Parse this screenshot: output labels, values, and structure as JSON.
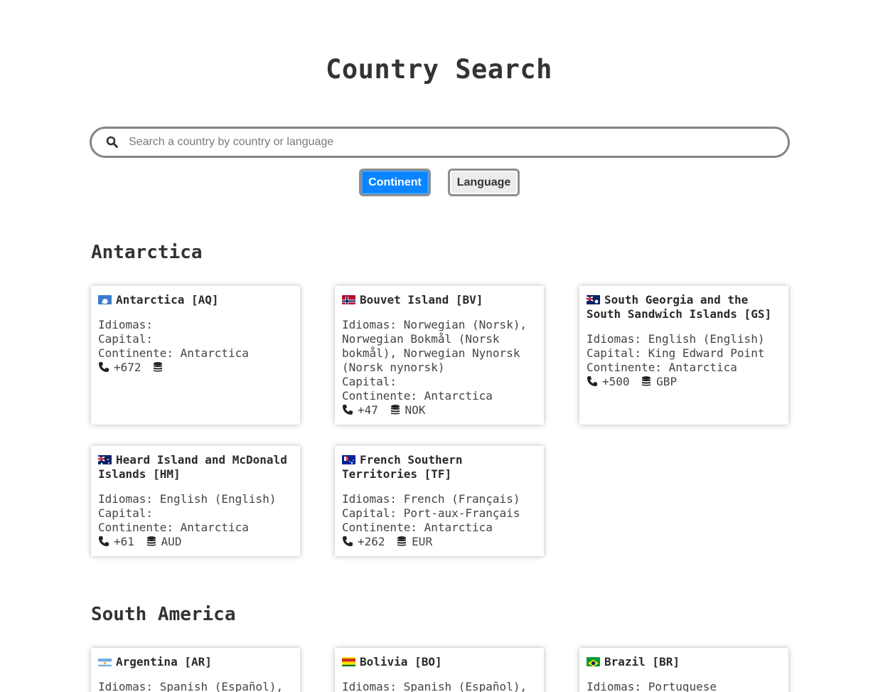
{
  "header": {
    "title": "Country Search"
  },
  "search": {
    "placeholder": "Search a country by country or language",
    "value": ""
  },
  "filters": {
    "continent_label": "Continent",
    "language_label": "Language"
  },
  "sections": [
    {
      "title": "Antarctica",
      "countries": [
        {
          "name": "Antarctica [AQ]",
          "idiomas": "Idiomas:",
          "capital": "Capital:",
          "continente": "Continente: Antarctica",
          "phone": "+672",
          "currency": "",
          "flag": "aq"
        },
        {
          "name": "Bouvet Island [BV]",
          "idiomas": "Idiomas: Norwegian (Norsk), Norwegian Bokmål (Norsk bokmål), Norwegian Nynorsk (Norsk nynorsk)",
          "capital": "Capital:",
          "continente": "Continente: Antarctica",
          "phone": "+47",
          "currency": "NOK",
          "flag": "bv"
        },
        {
          "name": "South Georgia and the South Sandwich Islands [GS]",
          "idiomas": "Idiomas: English (English)",
          "capital": "Capital: King Edward Point",
          "continente": "Continente: Antarctica",
          "phone": "+500",
          "currency": "GBP",
          "flag": "gs"
        },
        {
          "name": "Heard Island and McDonald Islands [HM]",
          "idiomas": "Idiomas: English (English)",
          "capital": "Capital:",
          "continente": "Continente: Antarctica",
          "phone": "+61",
          "currency": "AUD",
          "flag": "hm"
        },
        {
          "name": "French Southern Territories [TF]",
          "idiomas": "Idiomas: French (Français)",
          "capital": "Capital: Port-aux-Français",
          "continente": "Continente: Antarctica",
          "phone": "+262",
          "currency": "EUR",
          "flag": "tf"
        }
      ]
    },
    {
      "title": "South America",
      "countries": [
        {
          "name": "Argentina [AR]",
          "idiomas": "Idiomas: Spanish (Español),",
          "flag": "ar"
        },
        {
          "name": "Bolivia [BO]",
          "idiomas": "Idiomas: Spanish (Español),",
          "flag": "bo"
        },
        {
          "name": "Brazil [BR]",
          "idiomas": "Idiomas: Portuguese",
          "flag": "br"
        }
      ]
    }
  ],
  "colors": {
    "accent": "#0a84ff",
    "border": "#858585"
  },
  "icons": {
    "search": "search-icon",
    "phone": "phone-icon",
    "coins": "coins-icon"
  }
}
